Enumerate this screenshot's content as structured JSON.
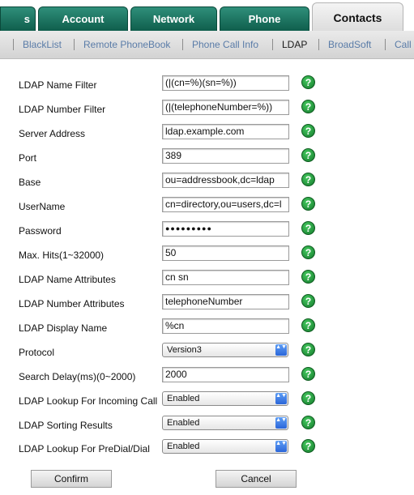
{
  "tabs": [
    {
      "label": "s",
      "left": 0,
      "width": 44
    },
    {
      "label": "Account"
    },
    {
      "label": "Network"
    },
    {
      "label": "Phone"
    },
    {
      "label": "Contacts"
    }
  ],
  "subnav": [
    "BlackList",
    "Remote PhoneBook",
    "Phone Call Info",
    "LDAP",
    "BroadSoft",
    "Call"
  ],
  "fields": [
    {
      "label": "LDAP Name Filter",
      "value": "(|(cn=%)(sn=%))"
    },
    {
      "label": "LDAP Number Filter",
      "value": "(|(telephoneNumber=%))"
    },
    {
      "label": "Server Address",
      "value": "ldap.example.com"
    },
    {
      "label": "Port",
      "value": "389"
    },
    {
      "label": "Base",
      "value": "ou=addressbook,dc=ldap"
    },
    {
      "label": "UserName",
      "value": "cn=directory,ou=users,dc=l"
    },
    {
      "label": "Password",
      "value": "●●●●●●●●●"
    },
    {
      "label": "Max. Hits(1~32000)",
      "value": "50"
    },
    {
      "label": "LDAP Name Attributes",
      "value": "cn sn"
    },
    {
      "label": "LDAP Number Attributes",
      "value": "telephoneNumber"
    },
    {
      "label": "LDAP Display Name",
      "value": "%cn"
    },
    {
      "label": "Protocol",
      "value": "Version3"
    },
    {
      "label": "Search Delay(ms)(0~2000)",
      "value": "2000"
    },
    {
      "label": "LDAP Lookup For Incoming Call",
      "value": "Enabled"
    },
    {
      "label": "LDAP Sorting Results",
      "value": "Enabled"
    },
    {
      "label": "LDAP Lookup For PreDial/Dial",
      "value": "Enabled"
    }
  ],
  "help_glyph": "?",
  "select_arrow": "▲▼",
  "buttons": {
    "confirm": "Confirm",
    "cancel": "Cancel"
  }
}
